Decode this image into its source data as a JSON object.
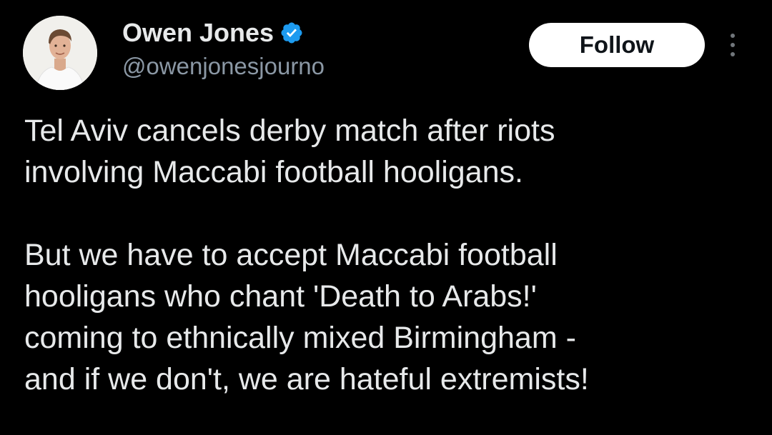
{
  "author": {
    "display_name": "Owen Jones",
    "handle": "@owenjonesjourno",
    "verified": true,
    "avatar_icon": "profile-photo"
  },
  "actions": {
    "follow_label": "Follow",
    "more_icon": "more-vertical-icon"
  },
  "tweet": {
    "paragraphs": [
      "Tel Aviv cancels derby match after riots\ninvolving Maccabi football hooligans.",
      "But we have to accept Maccabi football\nhooligans who chant 'Death to Arabs!'\ncoming to ethnically mixed Birmingham -\nand if we don't, we are hateful extremists!"
    ]
  },
  "colors": {
    "background": "#000000",
    "text": "#e7e9ea",
    "secondary_text": "#8b98a5",
    "verified_badge": "#1d9bf0",
    "follow_button_bg": "#ffffff",
    "follow_button_text": "#0f1419"
  }
}
